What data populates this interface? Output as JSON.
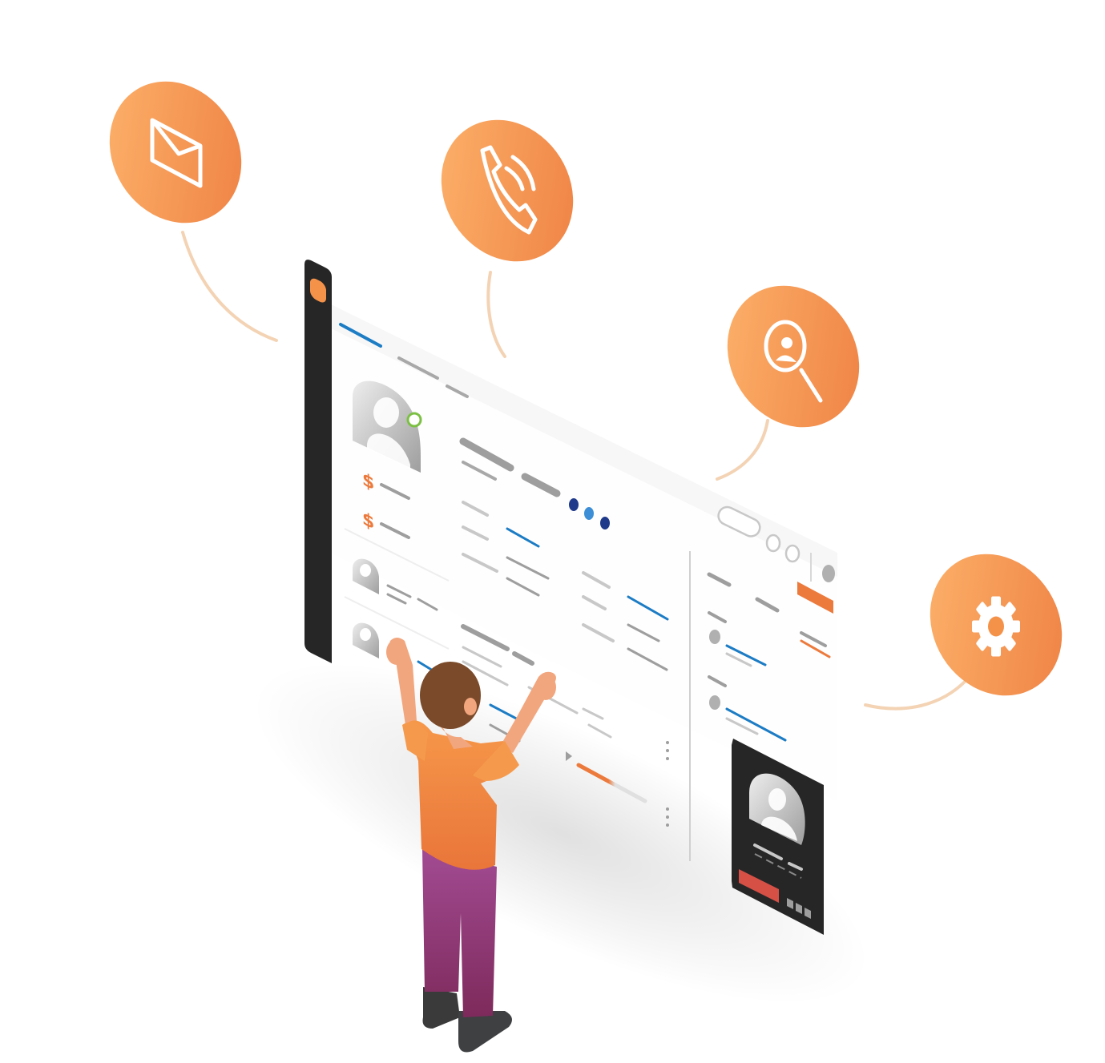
{
  "colors": {
    "accent": "#F5924A",
    "accent_light": "#FDB46C",
    "accent_dark": "#EC7A3C",
    "connector": "#F3D3B4",
    "sidebar": "#262626",
    "blue_line": "#1C7CC4",
    "gray_line": "#9E9E9E",
    "green_status": "#7CC043",
    "navy": "#1F3A8A",
    "skin": "#F2A67E",
    "hair": "#7A4A2A",
    "pants": "#8E3470",
    "shoes": "#3A3A3A"
  },
  "bubbles": [
    {
      "icon": "envelope-icon"
    },
    {
      "icon": "phone-icon"
    },
    {
      "icon": "user-search-icon"
    },
    {
      "icon": "gear-icon"
    }
  ],
  "dashboard": {
    "currency_symbol": "$"
  }
}
